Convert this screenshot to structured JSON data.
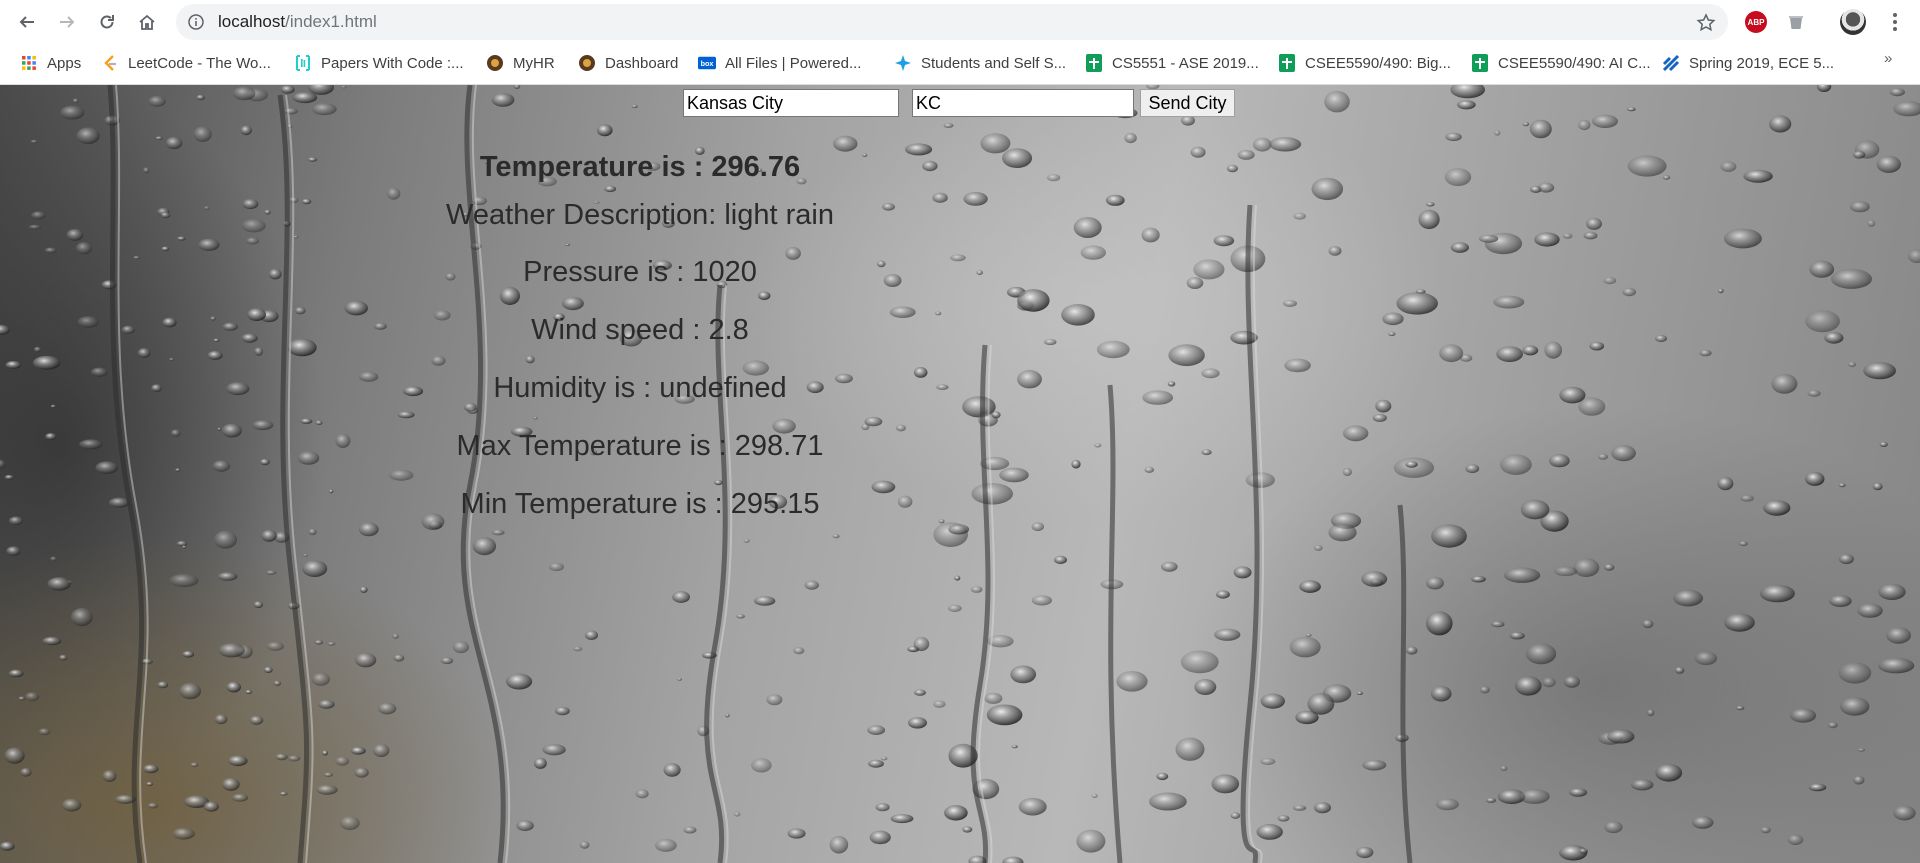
{
  "browser": {
    "url_host": "localhost",
    "url_path": "/index1.html",
    "extension_abp": "ABP"
  },
  "bookmarks": {
    "items": [
      {
        "label": "Apps",
        "icon": "apps-grid-icon"
      },
      {
        "label": "LeetCode - The Wo...",
        "icon": "leetcode-icon"
      },
      {
        "label": "Papers With Code :...",
        "icon": "papers-with-code-icon"
      },
      {
        "label": "MyHR",
        "icon": "myhr-icon"
      },
      {
        "label": "Dashboard",
        "icon": "dashboard-icon"
      },
      {
        "label": "All Files | Powered...",
        "icon": "box-icon"
      },
      {
        "label": "Students and Self S...",
        "icon": "students-icon"
      },
      {
        "label": "CS5551 - ASE 2019...",
        "icon": "google-sheets-icon"
      },
      {
        "label": "CSEE5590/490: Big...",
        "icon": "google-sheets-icon"
      },
      {
        "label": "CSEE5590/490: AI C...",
        "icon": "google-sheets-icon"
      },
      {
        "label": "Spring 2019, ECE 5...",
        "icon": "canvas-icon"
      }
    ],
    "more": "»"
  },
  "form": {
    "city_value": "Kansas City",
    "state_value": "KC",
    "send_label": "Send City"
  },
  "weather": {
    "temperature": "Temperature is : 296.76",
    "description": "Weather Description: light rain",
    "pressure": "Pressure is : 1020",
    "wind": "Wind speed : 2.8",
    "humidity": "Humidity is : undefined",
    "max_temp": "Max Temperature is : 298.71",
    "min_temp": "Min Temperature is : 295.15"
  },
  "colors": {
    "omnibox_bg": "#f1f3f4",
    "abp_red": "#c60c1e",
    "sheets_green": "#0f9d58",
    "text_dark": "#2b2b2b"
  }
}
